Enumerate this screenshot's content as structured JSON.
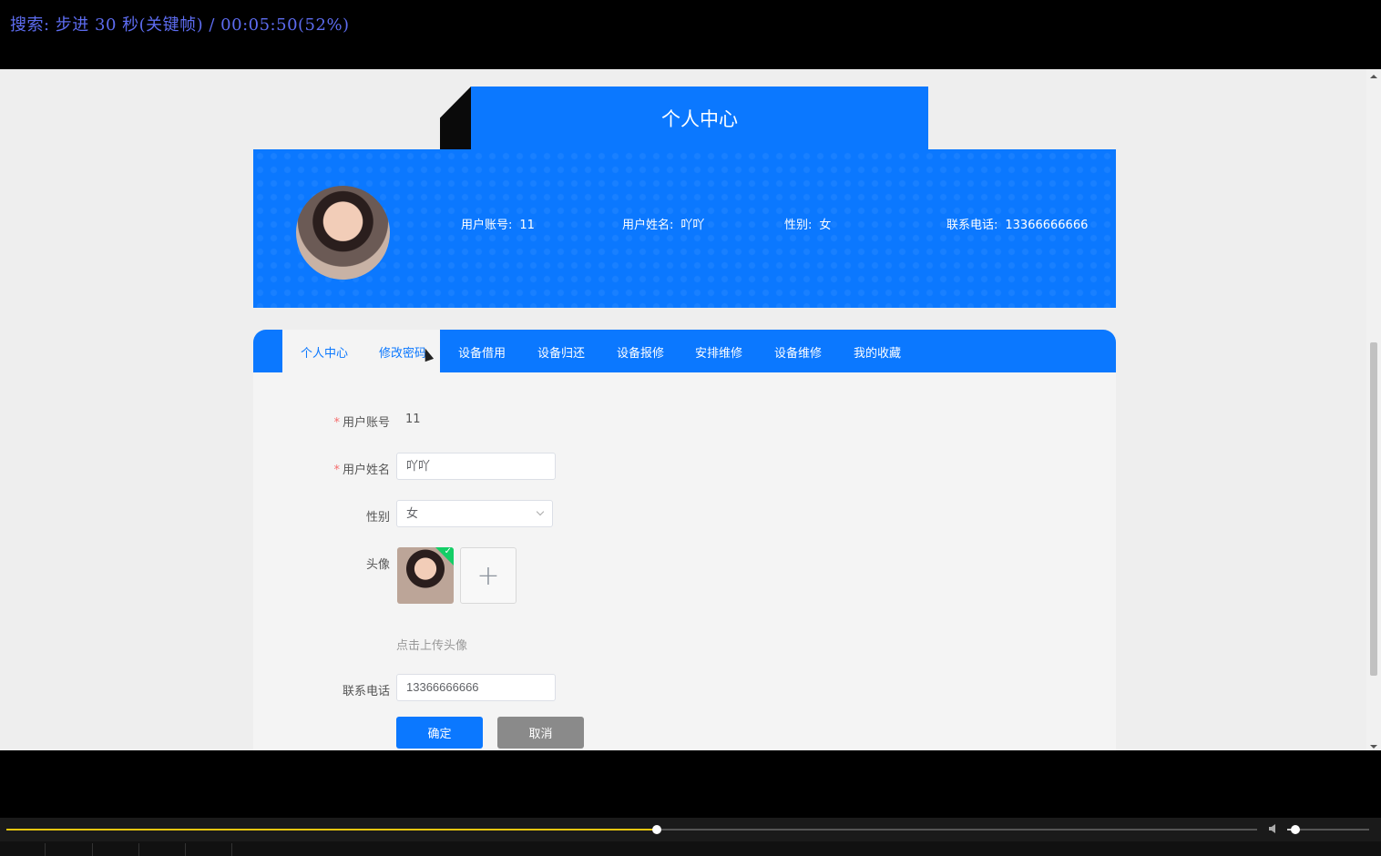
{
  "player": {
    "osd_text": "搜索: 步进 30 秒(关键帧) / 00:05:50(52%)",
    "progress_fraction": 0.52,
    "volume_fraction": 0.1,
    "accent_color": "#e6c60f"
  },
  "page": {
    "title": "个人中心",
    "accent_color": "#0b78ff"
  },
  "profile": {
    "account_label": "用户账号:",
    "account_value": "11",
    "name_label": "用户姓名:",
    "name_value": "吖吖",
    "gender_label": "性别:",
    "gender_value": "女",
    "phone_label": "联系电话:",
    "phone_value": "13366666666"
  },
  "tabs": [
    {
      "label": "个人中心"
    },
    {
      "label": "修改密码"
    },
    {
      "label": "设备借用"
    },
    {
      "label": "设备归还"
    },
    {
      "label": "设备报修"
    },
    {
      "label": "安排维修"
    },
    {
      "label": "设备维修"
    },
    {
      "label": "我的收藏"
    }
  ],
  "form": {
    "required_mark": "*",
    "account_label": "用户账号",
    "account_value": "11",
    "name_label": "用户姓名",
    "name_value": "吖吖",
    "gender_label": "性别",
    "gender_value": "女",
    "avatar_label": "头像",
    "upload_plus": "+",
    "upload_hint": "点击上传头像",
    "check_mark": "✓",
    "phone_label": "联系电话",
    "phone_value": "13366666666",
    "confirm_label": "确定",
    "cancel_label": "取消"
  }
}
